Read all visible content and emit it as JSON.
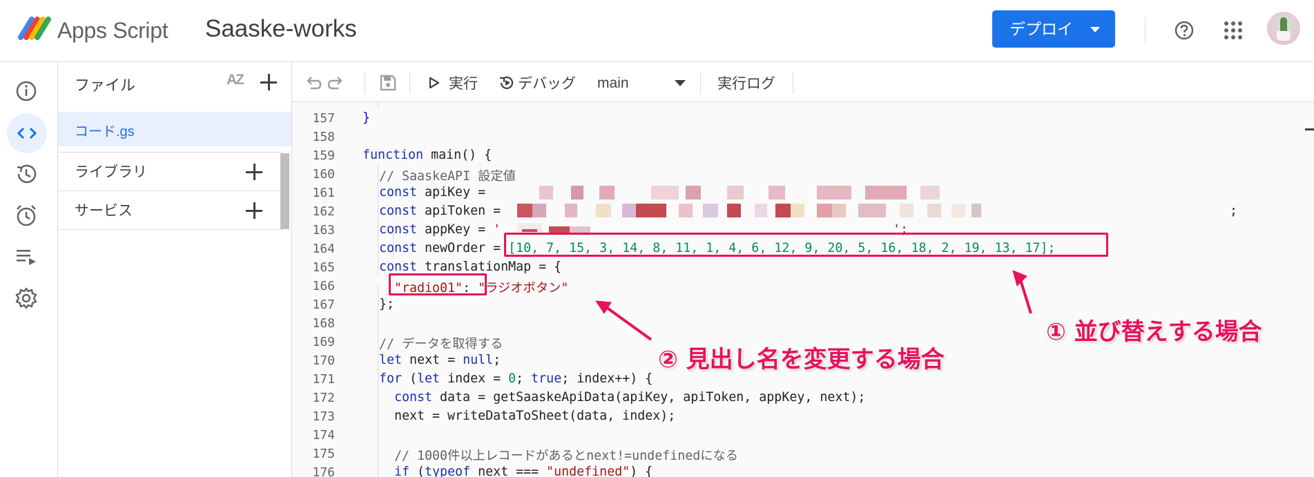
{
  "header": {
    "app_name": "Apps Script",
    "project_name": "Saaske-works",
    "deploy_label": "デプロイ"
  },
  "left_nav": [
    "info",
    "code",
    "history",
    "triggers",
    "executions",
    "settings"
  ],
  "files_panel": {
    "title": "ファイル",
    "sort_label": "AZ",
    "files": [
      "コード.gs"
    ],
    "libraries_label": "ライブラリ",
    "services_label": "サービス"
  },
  "toolbar": {
    "run_label": "実行",
    "debug_label": "デバッグ",
    "function_select": "main",
    "log_label": "実行ログ"
  },
  "editor": {
    "line_numbers": [
      "157",
      "158",
      "159",
      "160",
      "161",
      "162",
      "163",
      "164",
      "165",
      "166",
      "167",
      "168",
      "169",
      "170",
      "171",
      "172",
      "173",
      "174",
      "175",
      "176"
    ],
    "lines": {
      "l157": "}",
      "l159_kw": "function",
      "l159_rest": " main() {",
      "l160": "// SaaskeAPI 設定値",
      "l161_kw": "const",
      "l161_rest": " apiKey = ",
      "l162_kw": "const",
      "l162_rest": " apiToken = ",
      "l162_end": ";",
      "l163_kw": "const",
      "l163_rest": " appKey = ",
      "l163_str_open": "'",
      "l163_end": "';",
      "l164_kw": "const",
      "l164_rest": " newOrder = ",
      "l164_array": "[10, 7, 15, 3, 14, 8, 11, 1, 4, 6, 12, 9, 20, 5, 16, 18, 2, 19, 13, 17];",
      "l165_kw": "const",
      "l165_rest": " translationMap = {",
      "l166_key": "\"radio01\"",
      "l166_colon": ": ",
      "l166_val": "\"ラジオボタン\"",
      "l167": "};",
      "l169": "// データを取得する",
      "l170_kw": "let",
      "l170_rest": " next = ",
      "l170_null": "null",
      "l170_end": ";",
      "l171_kw1": "for",
      "l171_a": " (",
      "l171_kw2": "let",
      "l171_b": " index = ",
      "l171_zero": "0",
      "l171_c": "; ",
      "l171_true": "true",
      "l171_d": "; index++) {",
      "l172_kw": "const",
      "l172_rest": " data = getSaaskeApiData(apiKey, apiToken, appKey, next);",
      "l173": "next = writeDataToSheet(data, index);",
      "l175": "// 1000件以上レコードがあるとnext!=undefinedになる",
      "l176_kw1": "if",
      "l176_a": " (",
      "l176_kw2": "typeof",
      "l176_b": " next === ",
      "l176_str": "\"undefined\"",
      "l176_c": ") {"
    }
  },
  "annotations": {
    "sort_note": "① 並び替えする場合",
    "rename_note": "② 見出し名を変更する場合"
  },
  "colors": {
    "accent": "#1a73e8",
    "annotation": "#e8115b"
  }
}
